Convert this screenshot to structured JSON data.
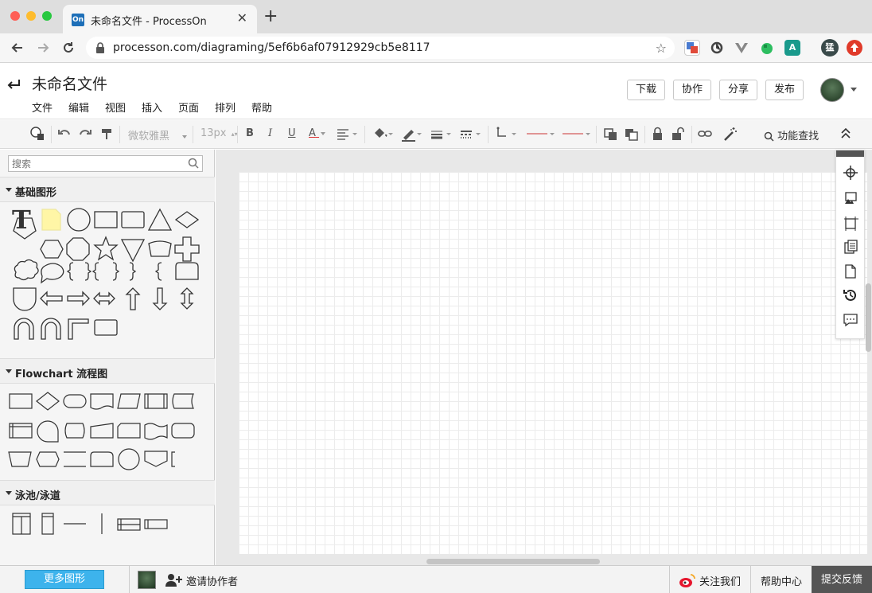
{
  "browser": {
    "tab_title": "未命名文件 - ProcessOn",
    "favicon_text": "On",
    "url": "processon.com/diagraming/5ef6b6af07912929cb5e8117",
    "extension_letter": "A",
    "profile_letter": "猛"
  },
  "app": {
    "doc_title": "未命名文件",
    "menu": [
      "文件",
      "编辑",
      "视图",
      "插入",
      "页面",
      "排列",
      "帮助"
    ],
    "buttons": {
      "download": "下载",
      "collaborate": "协作",
      "share": "分享",
      "publish": "发布"
    }
  },
  "toolbar": {
    "font_family": "微软雅黑",
    "font_size": "13px",
    "bold": "B",
    "italic": "I",
    "underline": "U",
    "font_color": "A",
    "search_label": "功能查找"
  },
  "sidebar": {
    "search_placeholder": "搜索",
    "sections": [
      {
        "label": "基础图形"
      },
      {
        "label": "Flowchart 流程图"
      },
      {
        "label": "泳池/泳道"
      }
    ],
    "more_shapes": "更多图形"
  },
  "bottom": {
    "invite": "邀请协作者",
    "follow": "关注我们",
    "help_center": "帮助中心",
    "feedback": "提交反馈"
  },
  "colors": {
    "accent": "#3db3ec",
    "feedback_bg": "#555555",
    "note_yellow": "#fff6a6"
  }
}
